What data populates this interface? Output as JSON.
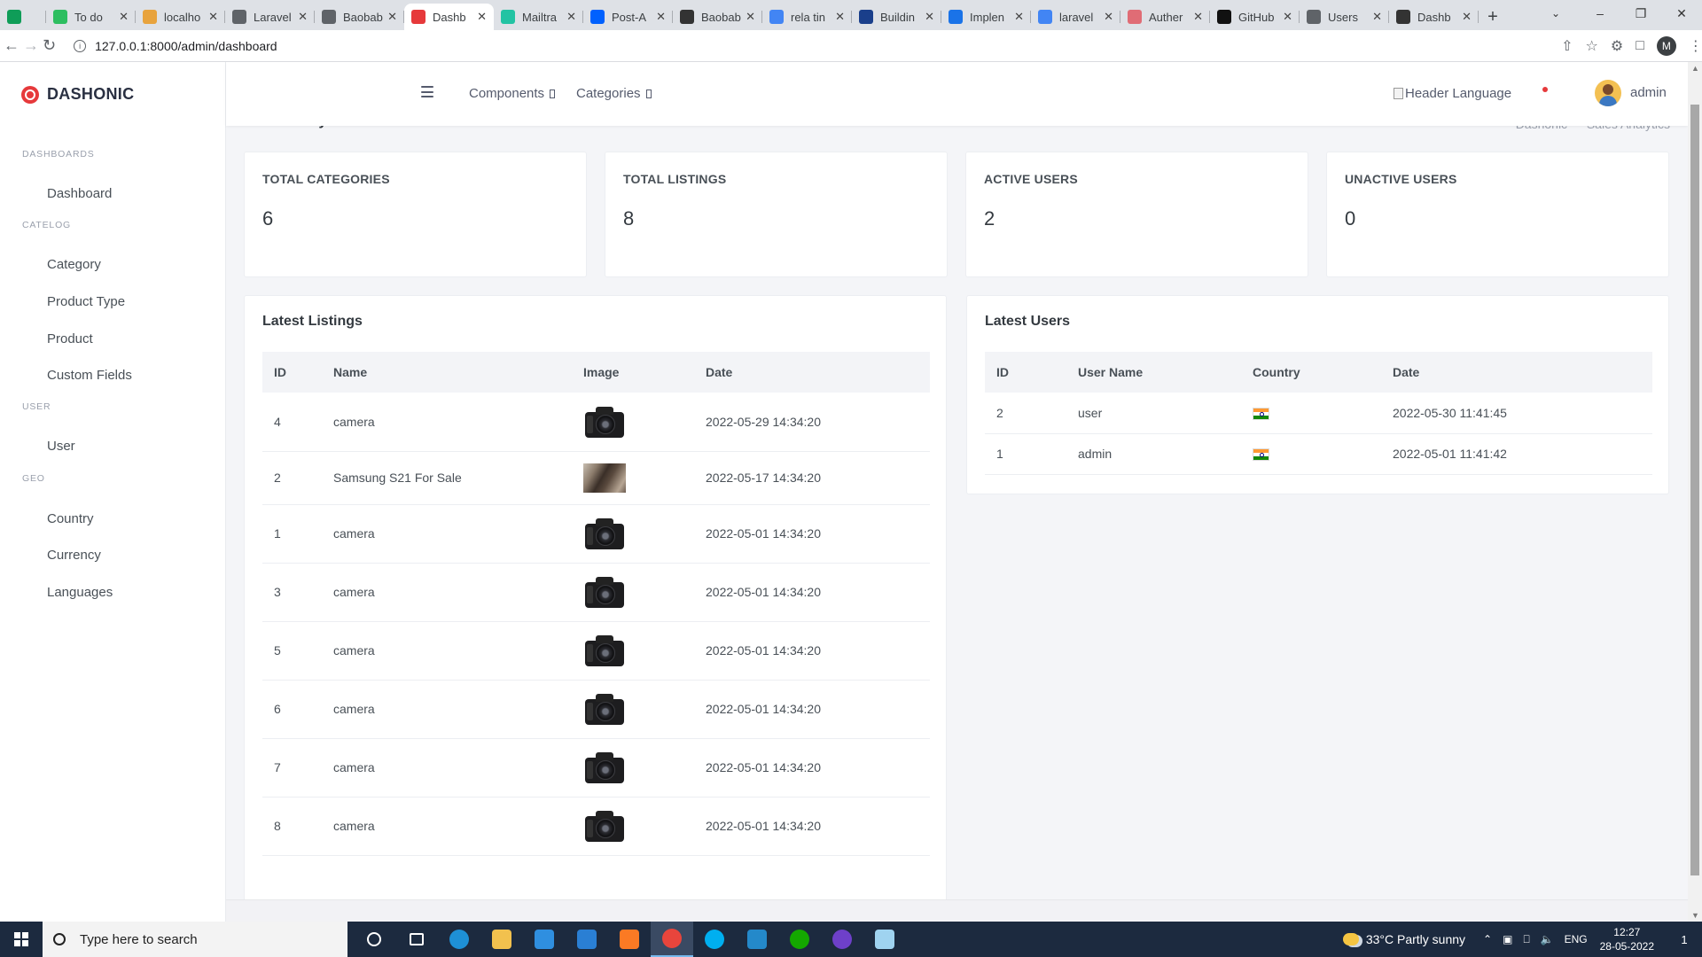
{
  "browser": {
    "tabs": [
      {
        "title": "",
        "icon": "sheets-icon",
        "color": "#0f9d58"
      },
      {
        "title": "To do",
        "icon": "evernote-icon",
        "color": "#2dbe60"
      },
      {
        "title": "localho",
        "icon": "phpmyadmin-icon",
        "color": "#e8a33d"
      },
      {
        "title": "Laravel",
        "icon": "chat-icon",
        "color": "#5f6368"
      },
      {
        "title": "Baobab",
        "icon": "chat-icon",
        "color": "#5f6368"
      },
      {
        "title": "Dashb",
        "icon": "dashonic-icon",
        "color": "#e6393b",
        "active": true
      },
      {
        "title": "Mailtra",
        "icon": "mailtrap-icon",
        "color": "#22c3a3"
      },
      {
        "title": "Post-A",
        "icon": "dropbox-icon",
        "color": "#0061fe"
      },
      {
        "title": "Baobab",
        "icon": "github-icon",
        "color": "#333333"
      },
      {
        "title": "rela tin",
        "icon": "google-icon",
        "color": "#4285f4"
      },
      {
        "title": "Buildin",
        "icon": "sp-icon",
        "color": "#1a3f8b"
      },
      {
        "title": "Implen",
        "icon": "code-icon",
        "color": "#1a73e8"
      },
      {
        "title": "laravel",
        "icon": "google-icon",
        "color": "#4285f4"
      },
      {
        "title": "Auther",
        "icon": "shield-icon",
        "color": "#e06c75"
      },
      {
        "title": "GitHub",
        "icon": "github-icon",
        "color": "#111111"
      },
      {
        "title": "Users",
        "icon": "chat-icon",
        "color": "#5f6368"
      },
      {
        "title": "Dashb",
        "icon": "search-icon",
        "color": "#333333"
      }
    ],
    "url": "127.0.0.1:8000/admin/dashboard",
    "profile_initial": "M"
  },
  "brand": {
    "name": "DASHONIC",
    "accent": "#e6393b"
  },
  "sidebar": {
    "sections": [
      {
        "title": "DASHBOARDS",
        "items": [
          "Dashboard"
        ]
      },
      {
        "title": "CATELOG",
        "items": [
          "Category",
          "Product Type",
          "Product",
          "Custom Fields"
        ]
      },
      {
        "title": "USER",
        "items": [
          "User"
        ]
      },
      {
        "title": "GEO",
        "items": [
          "Country",
          "Currency",
          "Languages"
        ]
      }
    ]
  },
  "topbar": {
    "nav": [
      "Components",
      "Categories"
    ],
    "language_alt": "Header Language",
    "username": "admin"
  },
  "page": {
    "title": "Sales Analytics",
    "breadcrumb": "Dashonic  —  Sales Analytics"
  },
  "stats": [
    {
      "label": "TOTAL CATEGORIES",
      "value": "6"
    },
    {
      "label": "TOTAL LISTINGS",
      "value": "8"
    },
    {
      "label": "ACTIVE USERS",
      "value": "2"
    },
    {
      "label": "UNACTIVE USERS",
      "value": "0"
    }
  ],
  "latest_listings": {
    "title": "Latest Listings",
    "columns": [
      "ID",
      "Name",
      "Image",
      "Date"
    ],
    "rows": [
      {
        "id": "4",
        "name": "camera",
        "image": "camera",
        "date": "2022-05-29 14:34:20"
      },
      {
        "id": "2",
        "name": "Samsung S21 For Sale",
        "image": "phone",
        "date": "2022-05-17 14:34:20"
      },
      {
        "id": "1",
        "name": "camera",
        "image": "camera",
        "date": "2022-05-01 14:34:20"
      },
      {
        "id": "3",
        "name": "camera",
        "image": "camera",
        "date": "2022-05-01 14:34:20"
      },
      {
        "id": "5",
        "name": "camera",
        "image": "camera",
        "date": "2022-05-01 14:34:20"
      },
      {
        "id": "6",
        "name": "camera",
        "image": "camera",
        "date": "2022-05-01 14:34:20"
      },
      {
        "id": "7",
        "name": "camera",
        "image": "camera",
        "date": "2022-05-01 14:34:20"
      },
      {
        "id": "8",
        "name": "camera",
        "image": "camera",
        "date": "2022-05-01 14:34:20"
      }
    ]
  },
  "latest_users": {
    "title": "Latest Users",
    "columns": [
      "ID",
      "User Name",
      "Country",
      "Date"
    ],
    "rows": [
      {
        "id": "2",
        "username": "user",
        "country": "india-flag",
        "date": "2022-05-30 11:41:45"
      },
      {
        "id": "1",
        "username": "admin",
        "country": "india-flag",
        "date": "2022-05-01 11:41:42"
      }
    ]
  },
  "taskbar": {
    "search_placeholder": "Type here to search",
    "apps": [
      "cortana-icon",
      "task-view-icon",
      "edge-icon",
      "file-explorer-icon",
      "store-icon",
      "mail-icon",
      "xampp-icon",
      "chrome-icon",
      "skype-icon",
      "vscode-icon",
      "upwork-icon",
      "github-desktop-icon",
      "notepad-icon"
    ],
    "weather": "33°C  Partly sunny",
    "lang": "ENG",
    "time": "12:27",
    "date": "28-05-2022",
    "notifications": "1"
  }
}
